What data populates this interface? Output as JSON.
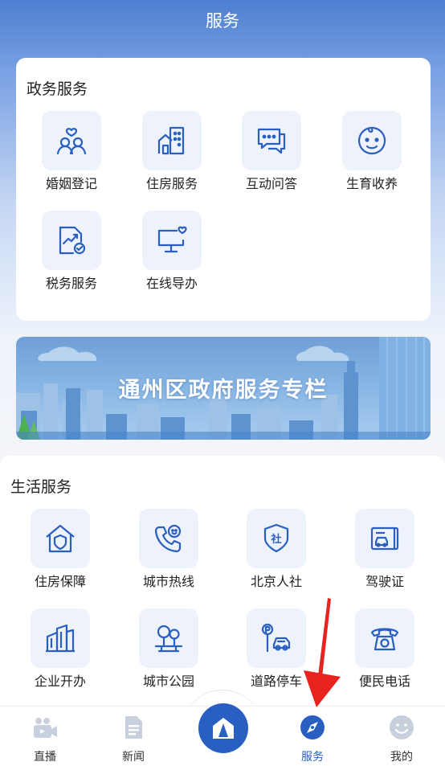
{
  "header": {
    "title": "服务"
  },
  "gov": {
    "title": "政务服务",
    "items": [
      {
        "label": "婚姻登记",
        "icon": "marriage-couple-icon"
      },
      {
        "label": "住房服务",
        "icon": "housing-building-icon"
      },
      {
        "label": "互动问答",
        "icon": "chat-bubbles-icon"
      },
      {
        "label": "生育收养",
        "icon": "baby-face-icon"
      },
      {
        "label": "税务服务",
        "icon": "tax-document-icon"
      },
      {
        "label": "在线导办",
        "icon": "monitor-heart-icon"
      }
    ]
  },
  "banner": {
    "text": "通州区政府服务专栏"
  },
  "life": {
    "title": "生活服务",
    "items": [
      {
        "label": "住房保障",
        "icon": "house-shield-icon"
      },
      {
        "label": "城市热线",
        "icon": "phone-smile-icon"
      },
      {
        "label": "北京人社",
        "icon": "social-security-shield-icon"
      },
      {
        "label": "驾驶证",
        "icon": "driver-license-icon"
      },
      {
        "label": "企业开办",
        "icon": "office-buildings-icon"
      },
      {
        "label": "城市公园",
        "icon": "park-trees-icon"
      },
      {
        "label": "道路停车",
        "icon": "parking-car-icon"
      },
      {
        "label": "便民电话",
        "icon": "telephone-icon"
      }
    ]
  },
  "tabbar": {
    "items": [
      {
        "label": "直播",
        "icon": "live-camera-icon"
      },
      {
        "label": "新闻",
        "icon": "news-document-icon"
      },
      {
        "label": "服务",
        "icon": "compass-icon",
        "active": true
      },
      {
        "label": "我的",
        "icon": "smiley-face-icon"
      }
    ],
    "center_icon": "home-logo-icon"
  },
  "colors": {
    "accent": "#2a5fc2",
    "icon_bg": "#eef2fa",
    "annotation_arrow": "#e8231f"
  }
}
